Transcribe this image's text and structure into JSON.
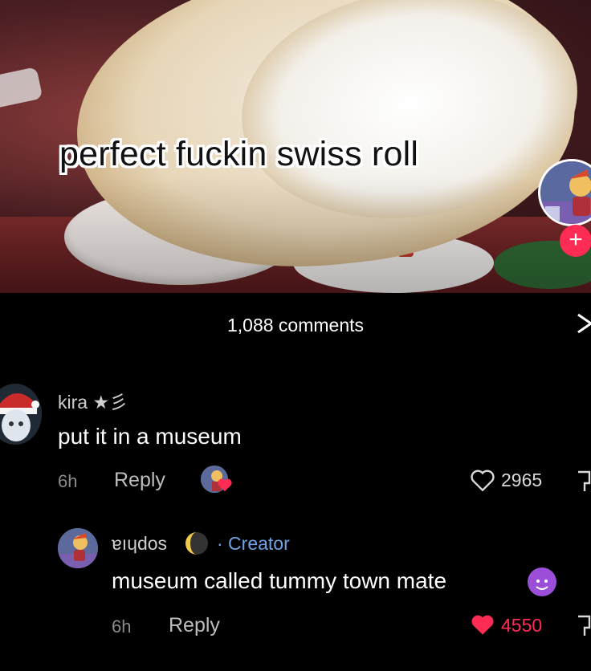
{
  "video": {
    "caption": "perfect fuckin swiss roll",
    "follow_label": "+"
  },
  "comments_panel": {
    "count_label": "1,088 comments",
    "close_label": "X"
  },
  "comments": [
    {
      "username": "kira",
      "username_suffix": "★彡",
      "text": "put it in a museum",
      "time": "6h",
      "reply_label": "Reply",
      "likes": "2965",
      "liked": false
    },
    {
      "username": "sophia",
      "username_display": "ɐıɥdos",
      "creator_label": "· Creator",
      "text": "museum called tummy town mate",
      "time": "6h",
      "reply_label": "Reply",
      "likes": "4550",
      "liked": true
    }
  ],
  "colors": {
    "background": "#000000",
    "like_active": "#fe2c55",
    "creator_tag": "#6fa3e6",
    "muted_text": "#8a8a8a"
  },
  "icons": [
    "heart-icon",
    "dislike-icon",
    "close-icon",
    "follow-plus-icon",
    "devil-emoji-icon",
    "moon-emoji-icon"
  ]
}
